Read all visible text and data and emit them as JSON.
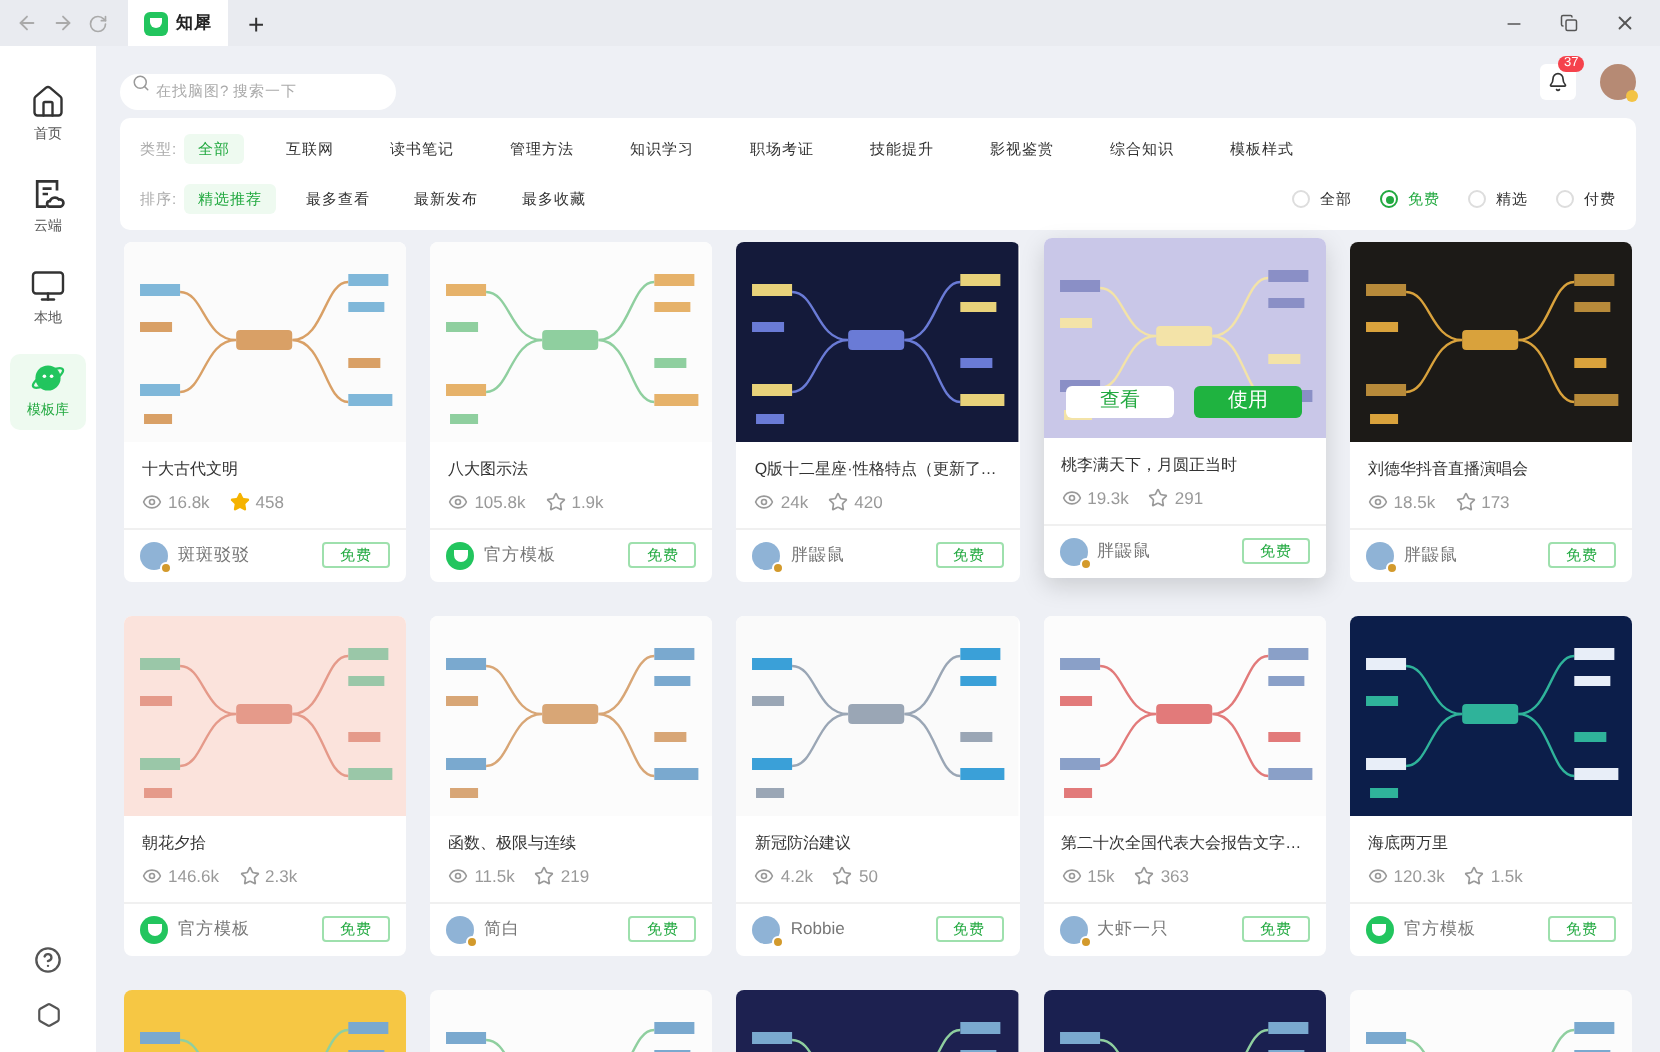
{
  "browser_tab": {
    "title": "知犀",
    "add": "+"
  },
  "sidebar": {
    "items": [
      {
        "label": "首页",
        "selected": false
      },
      {
        "label": "云端",
        "selected": false
      },
      {
        "label": "本地",
        "selected": false
      },
      {
        "label": "模板库",
        "selected": true
      }
    ]
  },
  "search": {
    "placeholder": "在找脑图? 搜索一下"
  },
  "notifications": {
    "count": "37"
  },
  "filters": {
    "type_label": "类型:",
    "types": [
      {
        "label": "全部",
        "selected": true
      },
      {
        "label": "互联网",
        "selected": false
      },
      {
        "label": "读书笔记",
        "selected": false
      },
      {
        "label": "管理方法",
        "selected": false
      },
      {
        "label": "知识学习",
        "selected": false
      },
      {
        "label": "职场考证",
        "selected": false
      },
      {
        "label": "技能提升",
        "selected": false
      },
      {
        "label": "影视鉴赏",
        "selected": false
      },
      {
        "label": "综合知识",
        "selected": false
      },
      {
        "label": "模板样式",
        "selected": false
      }
    ],
    "sort_label": "排序:",
    "sorts": [
      {
        "label": "精选推荐",
        "selected": true
      },
      {
        "label": "最多查看",
        "selected": false
      },
      {
        "label": "最新发布",
        "selected": false
      },
      {
        "label": "最多收藏",
        "selected": false
      }
    ],
    "prices": [
      {
        "label": "全部",
        "selected": false
      },
      {
        "label": "免费",
        "selected": true
      },
      {
        "label": "精选",
        "selected": false
      },
      {
        "label": "付费",
        "selected": false
      }
    ]
  },
  "cards": [
    {
      "title": "十大古代文明",
      "views": "16.8k",
      "stars": "458",
      "favorited": true,
      "author": "斑斑驳驳",
      "kind": "user",
      "price": "免费",
      "hovered": false
    },
    {
      "title": "八大图示法",
      "views": "105.8k",
      "stars": "1.9k",
      "favorited": false,
      "author": "官方模板",
      "kind": "official",
      "price": "免费",
      "hovered": false
    },
    {
      "title": "Q版十二星座·性格特点（更新了…",
      "views": "24k",
      "stars": "420",
      "favorited": false,
      "author": "胖鼹鼠",
      "kind": "user",
      "price": "免费",
      "hovered": false
    },
    {
      "title": "桃李满天下，月圆正当时",
      "views": "19.3k",
      "stars": "291",
      "favorited": false,
      "author": "胖鼹鼠",
      "kind": "user",
      "price": "免费",
      "hovered": true,
      "actions": [
        "查看",
        "使用"
      ]
    },
    {
      "title": "刘德华抖音直播演唱会",
      "views": "18.5k",
      "stars": "173",
      "favorited": false,
      "author": "胖鼹鼠",
      "kind": "user",
      "price": "免费",
      "hovered": false
    },
    {
      "title": "朝花夕拾",
      "views": "146.6k",
      "stars": "2.3k",
      "favorited": false,
      "author": "官方模板",
      "kind": "official",
      "price": "免费",
      "hovered": false
    },
    {
      "title": "函数、极限与连续",
      "views": "11.5k",
      "stars": "219",
      "favorited": false,
      "author": "简白",
      "kind": "user",
      "price": "免费",
      "hovered": false
    },
    {
      "title": "新冠防治建议",
      "views": "4.2k",
      "stars": "50",
      "favorited": false,
      "author": "Robbie",
      "kind": "user",
      "price": "免费",
      "hovered": false
    },
    {
      "title": "第二十次全国代表大会报告文字…",
      "views": "15k",
      "stars": "363",
      "favorited": false,
      "author": "大虾一只",
      "kind": "user",
      "price": "免费",
      "hovered": false
    },
    {
      "title": "海底两万里",
      "views": "120.3k",
      "stars": "1.5k",
      "favorited": false,
      "author": "官方模板",
      "kind": "official",
      "price": "免费",
      "hovered": false
    }
  ]
}
